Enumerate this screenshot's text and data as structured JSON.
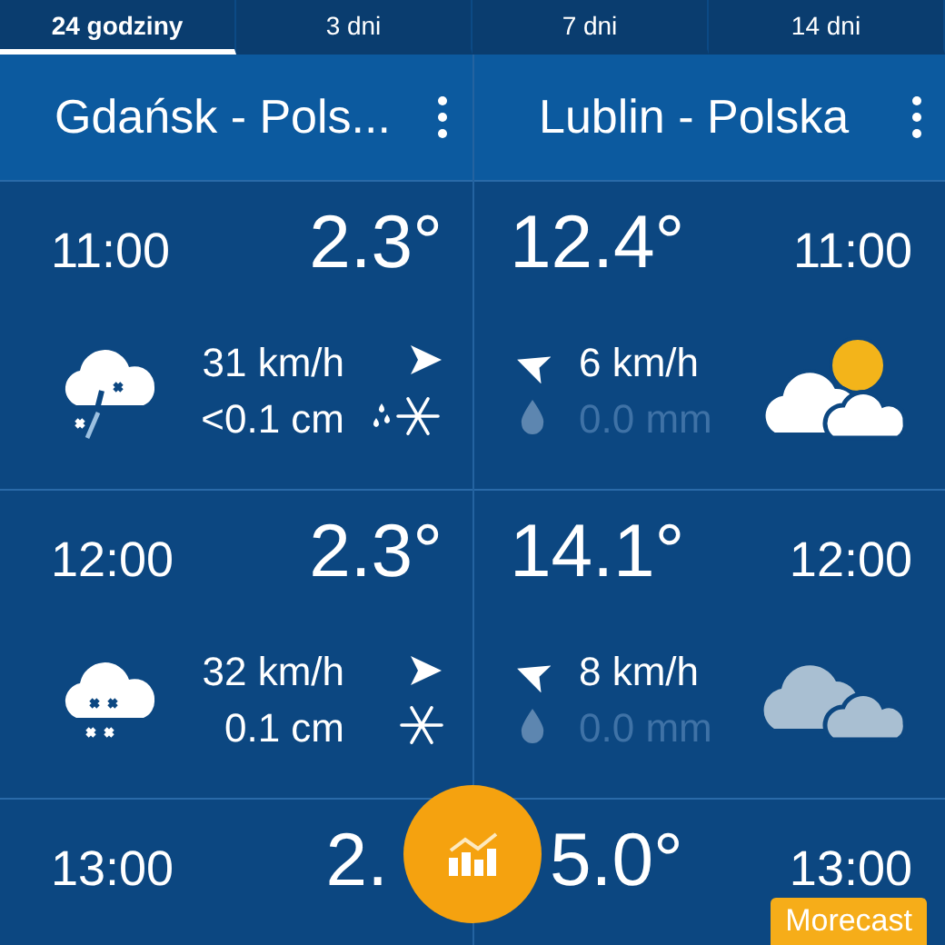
{
  "tabs": [
    {
      "label": "24 godziny",
      "selected": true
    },
    {
      "label": "3 dni",
      "selected": false
    },
    {
      "label": "7 dni",
      "selected": false
    },
    {
      "label": "14 dni",
      "selected": false
    }
  ],
  "locations": [
    {
      "name": "Gdańsk - Pols...",
      "hours": [
        {
          "time": "11:00",
          "temp": "2.3°",
          "weather_icon": {
            "kind": "sleet"
          },
          "wind": "31 km/h",
          "wind_arrow": {
            "kind": "east"
          },
          "precip": "<0.1 cm",
          "precip_icon": {
            "kind": "sleet"
          },
          "precip_active": true
        },
        {
          "time": "12:00",
          "temp": "2.3°",
          "weather_icon": {
            "kind": "snow"
          },
          "wind": "32 km/h",
          "wind_arrow": {
            "kind": "east"
          },
          "precip": "0.1 cm",
          "precip_icon": {
            "kind": "snow"
          },
          "precip_active": true
        },
        {
          "time": "13:00",
          "temp": "2."
        }
      ]
    },
    {
      "name": "Lublin - Polska",
      "hours": [
        {
          "time": "11:00",
          "temp": "12.4°",
          "weather_icon": {
            "kind": "partly-cloudy"
          },
          "wind": "6 km/h",
          "wind_arrow": {
            "kind": "southeast"
          },
          "precip": "0.0 mm",
          "precip_icon": {
            "kind": "rain"
          },
          "precip_active": false
        },
        {
          "time": "12:00",
          "temp": "14.1°",
          "weather_icon": {
            "kind": "cloudy"
          },
          "wind": "8 km/h",
          "wind_arrow": {
            "kind": "southeast"
          },
          "precip": "0.0 mm",
          "precip_icon": {
            "kind": "rain"
          },
          "precip_active": false
        },
        {
          "time": "13:00",
          "temp": "5.0°"
        }
      ]
    }
  ],
  "brand_badge": "Morecast"
}
